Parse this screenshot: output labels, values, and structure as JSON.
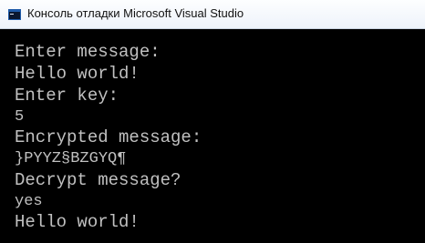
{
  "window": {
    "title": "Консоль отладки Microsoft Visual Studio",
    "icon": "console-icon"
  },
  "console": {
    "lines": [
      "Enter message:",
      "Hello world!",
      "Enter key:",
      "5",
      "Encrypted message:",
      "}PYYZ§BZGYQ¶",
      "Decrypt message?",
      "yes",
      "Hello world!"
    ],
    "text_color": "#c0c0c0",
    "background": "#000000"
  }
}
